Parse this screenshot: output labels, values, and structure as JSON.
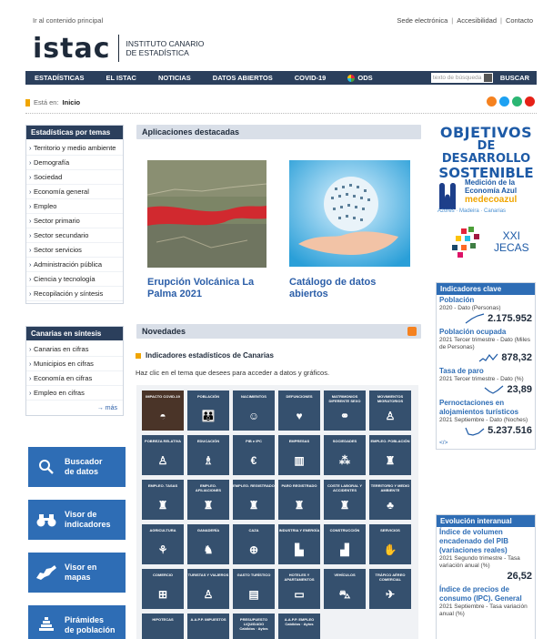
{
  "header": {
    "skip_link": "Ir al contenido principal",
    "util_links": [
      "Sede electrónica",
      "Accesibilidad",
      "Contacto"
    ],
    "logo_text": "istac",
    "logo_sub_1": "INSTITUTO CANARIO",
    "logo_sub_2": "DE ESTADÍSTICA"
  },
  "nav": {
    "items": [
      "ESTADÍSTICAS",
      "EL ISTAC",
      "NOTICIAS",
      "DATOS ABIERTOS",
      "COVID-19",
      "ODS"
    ],
    "search_placeholder": "texto de búsqueda",
    "search_button": "BUSCAR"
  },
  "breadcrumb": {
    "label": "Está en:",
    "current": "Inicio"
  },
  "colors": {
    "navy": "#2b3f5c",
    "blue": "#2e6db5",
    "rss": "#f58220"
  },
  "sidebar": {
    "temas_title": "Estadísticas por temas",
    "temas": [
      "Territorio y medio ambiente",
      "Demografía",
      "Sociedad",
      "Economía general",
      "Empleo",
      "Sector primario",
      "Sector secundario",
      "Sector servicios",
      "Administración pública",
      "Ciencia y tecnología",
      "Recopilación y síntesis"
    ],
    "sintesis_title": "Canarias en síntesis",
    "sintesis": [
      "Canarias en cifras",
      "Municipios en cifras",
      "Economía en cifras",
      "Empleo en cifras"
    ],
    "mas": "→ más",
    "tiles": [
      {
        "label1": "Buscador",
        "label2": "de datos",
        "icon": "search-icon"
      },
      {
        "label1": "Visor de",
        "label2": "indicadores",
        "icon": "binoculars-icon"
      },
      {
        "label1": "Visor en",
        "label2": "mapas",
        "icon": "island-map-icon"
      },
      {
        "label1": "Pirámides",
        "label2": "de población",
        "icon": "pyramid-icon"
      }
    ]
  },
  "main": {
    "apps_title": "Aplicaciones destacadas",
    "apps": [
      {
        "title1": "Erupción Volcánica La",
        "title2": "Palma 2021"
      },
      {
        "title1": "Catálogo de datos",
        "title2": "abiertos"
      }
    ],
    "novedades_title": "Novedades",
    "indicadores_title": "Indicadores estadísticos de Canarias",
    "indicadores_help": "Haz clic en el tema que desees para acceder a datos y gráficos.",
    "grid": [
      [
        "IMPACTO COVID-19",
        "POBLACIÓN",
        "NACIMIENTOS",
        "DEFUNCIONES",
        "MATRIMONIOS DIFERENTE SEXO",
        "MOVIMIENTOS MIGRATORIOS"
      ],
      [
        "POBREZA RELATIVA",
        "EDUCACIÓN",
        "PIB e IPC",
        "EMPRESAS",
        "SOCIEDADES",
        "EMPLEO. POBLACIÓN"
      ],
      [
        "EMPLEO. TASAS",
        "EMPLEO. AFILIACIONES",
        "EMPLEO. REGISTRADO",
        "PARO REGISTRADO",
        "COSTE LABORAL Y ACCIDENTES",
        "TERRITORIO Y MEDIO AMBIENTE"
      ],
      [
        "AGRICULTURA",
        "GANADERÍA",
        "CAZA",
        "INDUSTRIA Y ENERGÍA",
        "CONSTRUCCIÓN",
        "SERVICIOS"
      ],
      [
        "COMERCIO",
        "TURISTAS Y VIAJEROS",
        "GASTO TURÍSTICO",
        "HOTELES Y APARTAMENTOS",
        "VEHÍCULOS",
        "TRÁFICO AÉREO COMERCIAL"
      ],
      [
        "HIPOTECAS",
        "A.A.P.P. IMPUESTOS",
        "PRESUPUESTO LIQUIDADO",
        "A.A.P.P. EMPLEO"
      ]
    ],
    "grid_sub": {
      "c2": "Cabildos · Aytos",
      "c3": "Cabildos · Aytos"
    }
  },
  "right": {
    "ods_l1": "OBJETIVOS",
    "ods_l2": "DE DESARROLLO",
    "ods_l3": "SOSTENIBLE",
    "azul_l1": "Medición de la",
    "azul_l2": "Economía Azul",
    "azul_l3": "medecoazul",
    "azul_l4": "Azores · Madeira · Canarias",
    "jecas_l1": "XXI",
    "jecas_l2": "JECAS",
    "clave_title": "Indicadores clave",
    "clave": [
      {
        "name": "Población",
        "desc": "2020 - Dato (Personas)",
        "value": "2.175.952"
      },
      {
        "name": "Población ocupada",
        "desc": "2021 Tercer trimestre - Dato (Miles de Personas)",
        "value": "878,32"
      },
      {
        "name": "Tasa de paro",
        "desc": "2021 Tercer trimestre - Dato (%)",
        "value": "23,89"
      },
      {
        "name": "Pernoctaciones en alojamientos turísticos",
        "desc": "2021 Septiembre - Dato (Noches)",
        "value": "5.237.516"
      }
    ],
    "clave_more": "</>",
    "evol_title": "Evolución interanual",
    "evol": [
      {
        "name": "Índice de volumen encadenado del PIB (variaciones reales)",
        "desc": "2021 Segundo trimestre - Tasa variación anual (%)",
        "value": "26,52"
      },
      {
        "name": "Índice de precios de consumo (IPC). General",
        "desc": "2021 Septiembre - Tasa variación anual (%)",
        "value": ""
      }
    ]
  }
}
